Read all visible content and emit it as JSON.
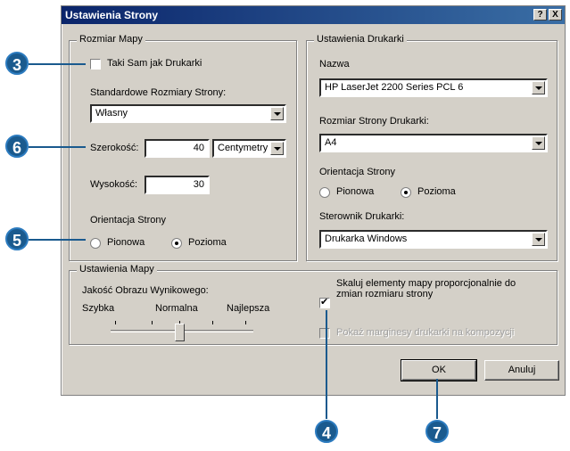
{
  "window": {
    "title": "Ustawienia Strony",
    "help_button": "?",
    "close_button": "X"
  },
  "map_size": {
    "legend": "Rozmiar Mapy",
    "same_as_printer_label": "Taki Sam jak Drukarki",
    "same_as_printer_checked": false,
    "standard_sizes_label": "Standardowe Rozmiary Strony:",
    "standard_size_value": "Własny",
    "width_label": "Szerokość:",
    "width_value": "40",
    "units_value": "Centymetry",
    "height_label": "Wysokość:",
    "height_value": "30",
    "orientation_label": "Orientacja Strony",
    "orientation_portrait": "Pionowa",
    "orientation_landscape": "Pozioma",
    "orientation_selected": "Pozioma"
  },
  "printer_settings": {
    "legend": "Ustawienia Drukarki",
    "name_label": "Nazwa",
    "name_value": "HP LaserJet 2200 Series PCL 6",
    "paper_size_label": "Rozmiar Strony Drukarki:",
    "paper_size_value": "A4",
    "orientation_label": "Orientacja Strony",
    "orientation_portrait": "Pionowa",
    "orientation_landscape": "Pozioma",
    "orientation_selected": "Pozioma",
    "driver_label": "Sterownik Drukarki:",
    "driver_value": "Drukarka Windows"
  },
  "map_settings": {
    "legend": "Ustawienia Mapy",
    "quality_label": "Jakość Obrazu Wynikowego:",
    "quality_fast": "Szybka",
    "quality_normal": "Normalna",
    "quality_best": "Najlepsza",
    "quality_selected": "Normalna",
    "scale_elements_label": "Skaluj elementy mapy proporcjonalnie do zmian rozmiaru strony",
    "scale_elements_checked": true,
    "show_margins_label": "Pokaż marginesy drukarki na kompozycji",
    "show_margins_checked": false,
    "show_margins_disabled": true
  },
  "buttons": {
    "ok": "OK",
    "cancel": "Anuluj"
  },
  "callouts": [
    "3",
    "6",
    "5",
    "4",
    "7"
  ],
  "colors": {
    "titlebar_start": "#0a246a",
    "titlebar_end": "#3a6ea5",
    "dialog_face": "#d4d0c8",
    "callout": "#1a5a8e"
  }
}
